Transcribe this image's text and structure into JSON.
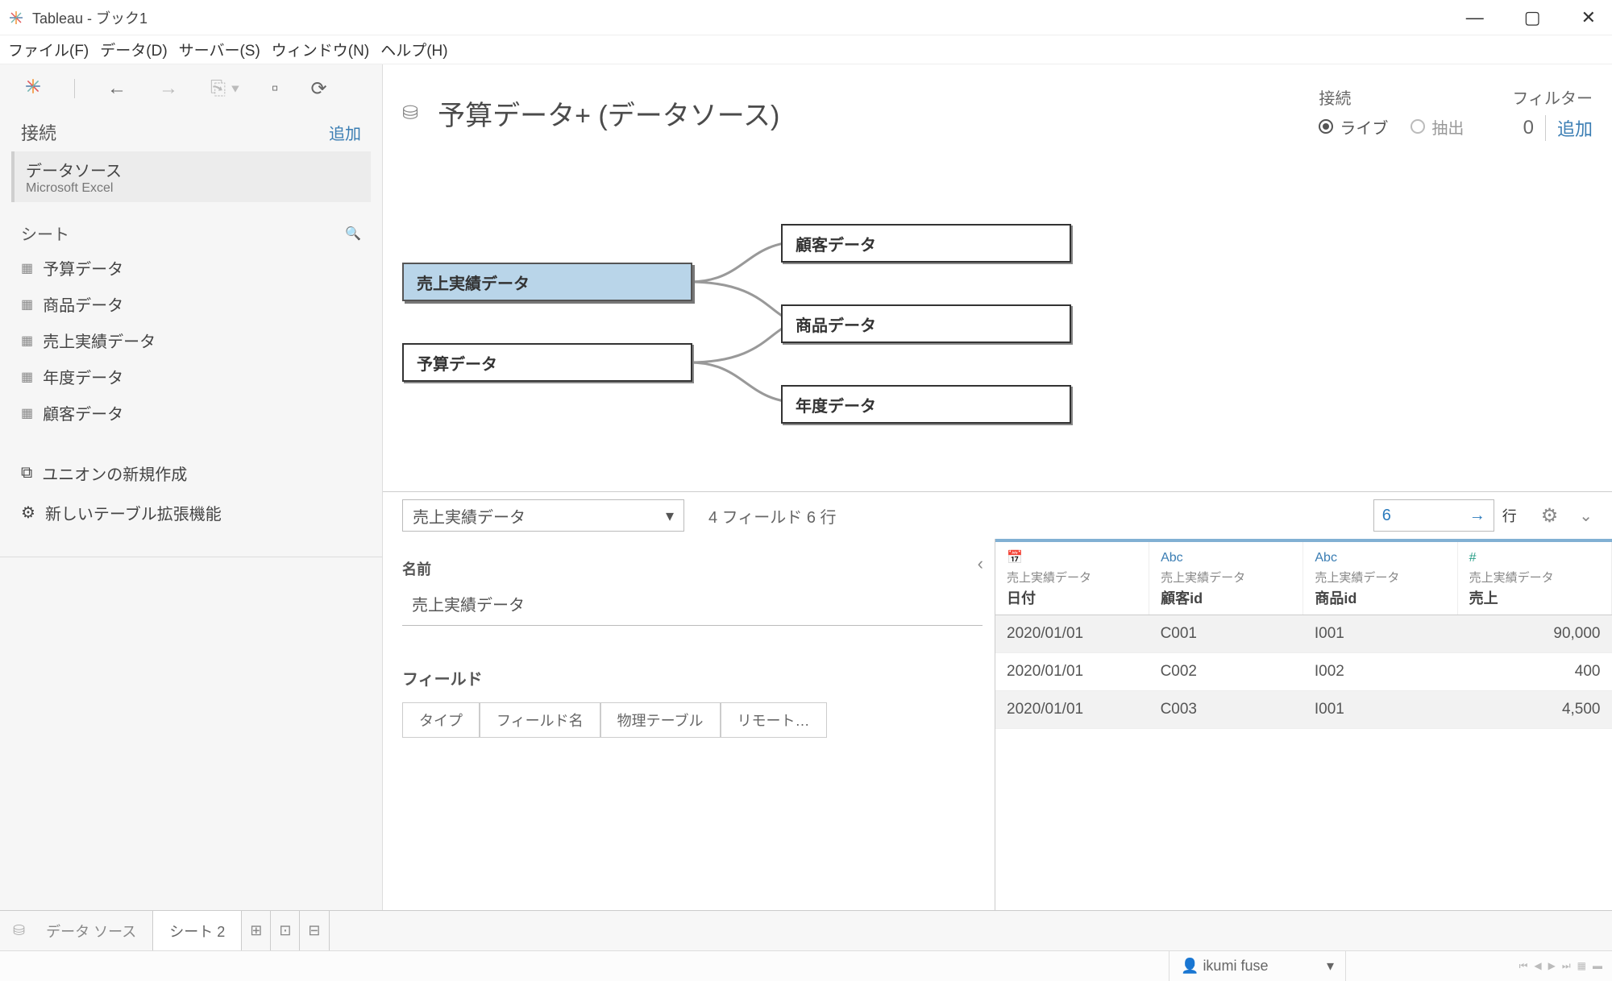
{
  "app": {
    "title": "Tableau - ブック1"
  },
  "menu": {
    "file": "ファイル(F)",
    "data": "データ(D)",
    "server": "サーバー(S)",
    "window": "ウィンドウ(N)",
    "help": "ヘルプ(H)"
  },
  "sidebar": {
    "connections_label": "接続",
    "add_label": "追加",
    "connection": {
      "name": "データソース",
      "type": "Microsoft Excel"
    },
    "sheets_label": "シート",
    "sheets": [
      "予算データ",
      "商品データ",
      "売上実績データ",
      "年度データ",
      "顧客データ"
    ],
    "tools": {
      "new_union": "ユニオンの新規作成",
      "new_table_ext": "新しいテーブル拡張機能"
    }
  },
  "datasource": {
    "title": "予算データ+ (データソース)",
    "connection_label": "接続",
    "live_label": "ライブ",
    "extract_label": "抽出",
    "filter_label": "フィルター",
    "filter_count": "0",
    "filter_add": "追加"
  },
  "canvas": {
    "primary": "売上実績データ",
    "budget": "予算データ",
    "customer": "顧客データ",
    "product": "商品データ",
    "year": "年度データ"
  },
  "preview": {
    "selector": "売上実績データ",
    "summary": "4 フィールド 6 行",
    "rows_value": "6",
    "rows_label": "行",
    "name_label": "名前",
    "name_value": "売上実績データ",
    "fields_label": "フィールド",
    "field_tabs": [
      "タイプ",
      "フィールド名",
      "物理テーブル",
      "リモート…"
    ],
    "columns": [
      {
        "type": "date",
        "type_label": "📅",
        "src": "売上実績データ",
        "name": "日付"
      },
      {
        "type": "abc",
        "type_label": "Abc",
        "src": "売上実績データ",
        "name": "顧客id"
      },
      {
        "type": "abc",
        "type_label": "Abc",
        "src": "売上実績データ",
        "name": "商品id"
      },
      {
        "type": "num",
        "type_label": "#",
        "src": "売上実績データ",
        "name": "売上"
      }
    ],
    "rows": [
      {
        "date": "2020/01/01",
        "customer": "C001",
        "product": "I001",
        "sales": "90,000"
      },
      {
        "date": "2020/01/01",
        "customer": "C002",
        "product": "I002",
        "sales": "400"
      },
      {
        "date": "2020/01/01",
        "customer": "C003",
        "product": "I001",
        "sales": "4,500"
      }
    ]
  },
  "tabs": {
    "datasource": "データ ソース",
    "sheet2": "シート 2"
  },
  "status": {
    "user": "ikumi fuse"
  }
}
